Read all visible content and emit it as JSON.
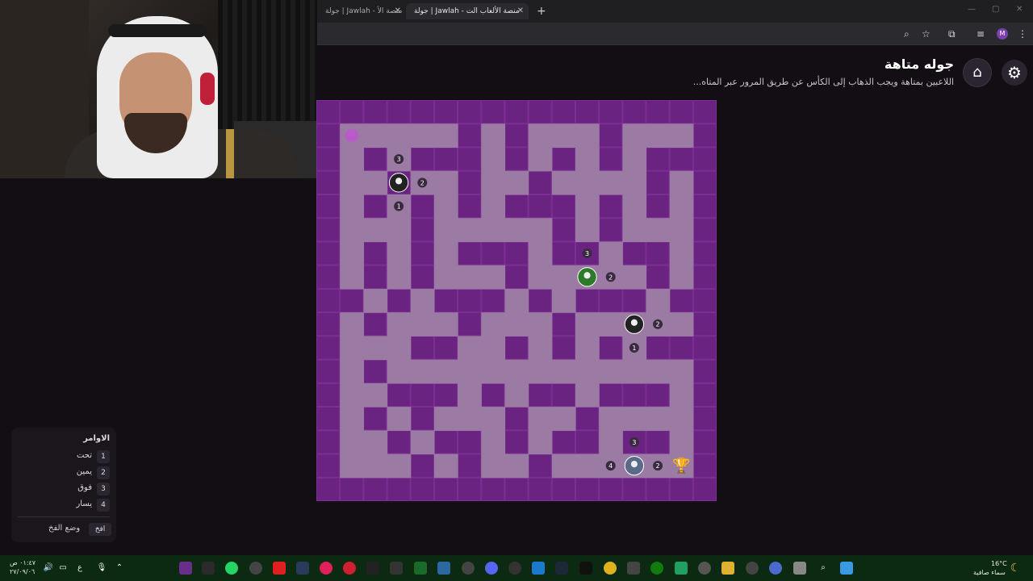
{
  "browser": {
    "tabs": [
      {
        "title": "جولة | Jawlah - منصة الأ",
        "active": false
      },
      {
        "title": "جولة | Jawlah - منصة الألعاب الت",
        "active": false
      },
      {
        "title": "جولة | Jawlah - منصة الألعاب الت",
        "active": true
      }
    ],
    "new_tab": "+",
    "profile_initial": "M"
  },
  "game": {
    "title": "جوله متاهة",
    "description": "اللاعبين بمتاهة ويجب الذهاب إلى الكأس عن طريق المرور عبر المتاه...",
    "settings_icon": "gear-icon",
    "home_icon": "home-icon"
  },
  "maze": {
    "cols": 17,
    "rows": 17,
    "path_color": "#9b7aa3",
    "wall_color": "#6a2381",
    "open_cells": [
      [
        1,
        1
      ],
      [
        2,
        1
      ],
      [
        3,
        1
      ],
      [
        4,
        1
      ],
      [
        5,
        1
      ],
      [
        7,
        1
      ],
      [
        9,
        1
      ],
      [
        10,
        1
      ],
      [
        11,
        1
      ],
      [
        13,
        1
      ],
      [
        14,
        1
      ],
      [
        15,
        1
      ],
      [
        1,
        2
      ],
      [
        3,
        2
      ],
      [
        7,
        2
      ],
      [
        9,
        2
      ],
      [
        11,
        2
      ],
      [
        13,
        2
      ],
      [
        1,
        3
      ],
      [
        2,
        3
      ],
      [
        4,
        3
      ],
      [
        5,
        3
      ],
      [
        7,
        3
      ],
      [
        8,
        3
      ],
      [
        10,
        3
      ],
      [
        11,
        3
      ],
      [
        12,
        3
      ],
      [
        13,
        3
      ],
      [
        15,
        3
      ],
      [
        1,
        4
      ],
      [
        3,
        4
      ],
      [
        5,
        4
      ],
      [
        7,
        4
      ],
      [
        11,
        4
      ],
      [
        13,
        4
      ],
      [
        15,
        4
      ],
      [
        1,
        5
      ],
      [
        2,
        5
      ],
      [
        3,
        5
      ],
      [
        5,
        5
      ],
      [
        6,
        5
      ],
      [
        7,
        5
      ],
      [
        8,
        5
      ],
      [
        9,
        5
      ],
      [
        11,
        5
      ],
      [
        13,
        5
      ],
      [
        14,
        5
      ],
      [
        15,
        5
      ],
      [
        1,
        6
      ],
      [
        3,
        6
      ],
      [
        5,
        6
      ],
      [
        9,
        6
      ],
      [
        12,
        6
      ],
      [
        15,
        6
      ],
      [
        1,
        7
      ],
      [
        3,
        7
      ],
      [
        5,
        7
      ],
      [
        6,
        7
      ],
      [
        7,
        7
      ],
      [
        9,
        7
      ],
      [
        10,
        7
      ],
      [
        11,
        7
      ],
      [
        12,
        7
      ],
      [
        13,
        7
      ],
      [
        15,
        7
      ],
      [
        2,
        8
      ],
      [
        4,
        8
      ],
      [
        8,
        8
      ],
      [
        10,
        8
      ],
      [
        14,
        8
      ],
      [
        1,
        9
      ],
      [
        3,
        9
      ],
      [
        4,
        9
      ],
      [
        5,
        9
      ],
      [
        7,
        9
      ],
      [
        8,
        9
      ],
      [
        9,
        9
      ],
      [
        11,
        9
      ],
      [
        12,
        9
      ],
      [
        13,
        9
      ],
      [
        14,
        9
      ],
      [
        15,
        9
      ],
      [
        1,
        10
      ],
      [
        2,
        10
      ],
      [
        3,
        10
      ],
      [
        6,
        10
      ],
      [
        7,
        10
      ],
      [
        9,
        10
      ],
      [
        11,
        10
      ],
      [
        13,
        10
      ],
      [
        1,
        11
      ],
      [
        3,
        11
      ],
      [
        4,
        11
      ],
      [
        5,
        11
      ],
      [
        6,
        11
      ],
      [
        7,
        11
      ],
      [
        8,
        11
      ],
      [
        9,
        11
      ],
      [
        10,
        11
      ],
      [
        11,
        11
      ],
      [
        12,
        11
      ],
      [
        13,
        11
      ],
      [
        14,
        11
      ],
      [
        15,
        11
      ],
      [
        1,
        12
      ],
      [
        2,
        12
      ],
      [
        6,
        12
      ],
      [
        8,
        12
      ],
      [
        11,
        12
      ],
      [
        15,
        12
      ],
      [
        1,
        13
      ],
      [
        3,
        13
      ],
      [
        5,
        13
      ],
      [
        6,
        13
      ],
      [
        7,
        13
      ],
      [
        9,
        13
      ],
      [
        10,
        13
      ],
      [
        12,
        13
      ],
      [
        13,
        13
      ],
      [
        14,
        13
      ],
      [
        15,
        13
      ],
      [
        1,
        14
      ],
      [
        2,
        14
      ],
      [
        4,
        14
      ],
      [
        7,
        14
      ],
      [
        9,
        14
      ],
      [
        12,
        14
      ],
      [
        15,
        14
      ],
      [
        1,
        15
      ],
      [
        2,
        15
      ],
      [
        3,
        15
      ],
      [
        5,
        15
      ],
      [
        7,
        15
      ],
      [
        8,
        15
      ],
      [
        10,
        15
      ],
      [
        11,
        15
      ],
      [
        12,
        15
      ],
      [
        13,
        15
      ],
      [
        14,
        15
      ],
      [
        15,
        15
      ]
    ],
    "start_marker": {
      "col": 1,
      "row": 1,
      "color": "#b85bc8"
    },
    "players": [
      {
        "name": "player-1",
        "col": 3,
        "row": 3,
        "avatar_color": "#222",
        "labels": {
          "up": "3",
          "right": "2",
          "down": "1"
        }
      },
      {
        "name": "player-2",
        "col": 11,
        "row": 7,
        "avatar_color": "#2d7a2a",
        "labels": {
          "up": "3",
          "right": "2"
        }
      },
      {
        "name": "player-3",
        "col": 13,
        "row": 9,
        "avatar_color": "#222",
        "labels": {
          "right": "2",
          "down": "1"
        }
      },
      {
        "name": "player-4",
        "col": 13,
        "row": 15,
        "avatar_color": "#5a6a8a",
        "labels": {
          "up": "3",
          "right": "2",
          "left": "4"
        }
      }
    ],
    "trophy": {
      "col": 15,
      "row": 15,
      "symbol": "🏆"
    }
  },
  "commands": {
    "title": "الاوامر",
    "items": [
      {
        "key": "1",
        "label": "تحت"
      },
      {
        "key": "2",
        "label": "يمين"
      },
      {
        "key": "3",
        "label": "فوق"
      },
      {
        "key": "4",
        "label": "يسار"
      }
    ],
    "trap_key": "افخ",
    "trap_label": "وضع الفخ"
  },
  "taskbar": {
    "weather_temp": "16°C",
    "weather_desc": "سماء صافية",
    "time": "٠١:٤٧ ص",
    "date": "٢٧/٠٩/٠٦",
    "lang": "ع"
  }
}
